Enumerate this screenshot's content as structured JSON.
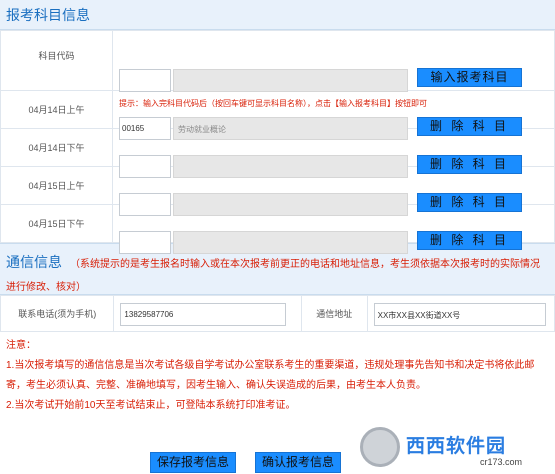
{
  "subject_section": {
    "title": "报考科目信息",
    "first_row": {
      "label": "科目代码",
      "code_value": "",
      "name_value": "",
      "button_label": "输入报考科目",
      "hint": "提示：输入完科目代码后（按回车键可显示科目名称），点击【输入报考科目】按钮即可"
    },
    "rows": [
      {
        "label": "04月14日上午",
        "code": "00165",
        "name": "劳动就业概论",
        "button": "删 除 科 目"
      },
      {
        "label": "04月14日下午",
        "code": "",
        "name": "",
        "button": "删 除 科 目"
      },
      {
        "label": "04月15日上午",
        "code": "",
        "name": "",
        "button": "删 除 科 目"
      },
      {
        "label": "04月15日下午",
        "code": "",
        "name": "",
        "button": "删 除 科 目"
      }
    ]
  },
  "comm_section": {
    "title": "通信信息",
    "note": "（系统提示的是考生报名时输入或在本次报考前更正的电话和地址信息，考生须依据本次报考时的实际情况进行修改、核对）",
    "phone_label": "联系电话(须为手机)",
    "phone_value": "13829587706",
    "address_label": "通信地址",
    "address_value": "XX市XX县XX街道XX号"
  },
  "notice": {
    "title": "注意：",
    "item1": "1.当次报考填写的通信信息是当次考试各级自学考试办公室联系考生的重要渠道，违规处理事先告知书和决定书将依此邮寄，考生必须认真、完整、准确地填写，因考生输入、确认失误造成的后果，由考生本人负责。",
    "item2": "2.当次考试开始前10天至考试结束止，可登陆本系统打印准考证。"
  },
  "buttons": {
    "save": "保存报考信息",
    "confirm": "确认报考信息"
  },
  "watermark": {
    "text": "西西软件园",
    "url": "cr173.com"
  },
  "colors": {
    "accent": "#1a8dff",
    "header_bg": "#e8f1fb",
    "header_text": "#1a6fc0",
    "warning": "#d81e06"
  }
}
